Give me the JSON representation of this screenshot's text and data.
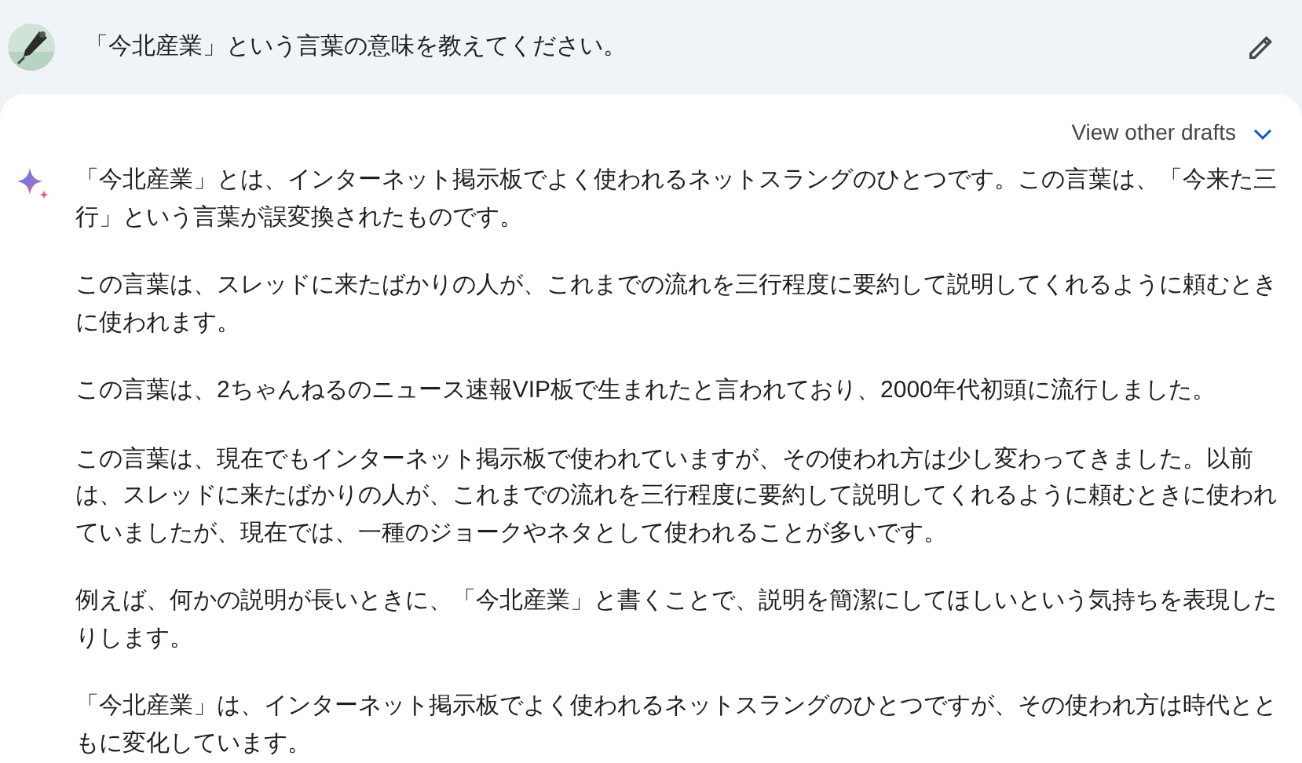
{
  "prompt": {
    "text": "「今北産業」という言葉の意味を教えてください。"
  },
  "response": {
    "drafts_label": "View other drafts",
    "drafts_expanded": false,
    "paragraphs": [
      "「今北産業」とは、インターネット掲示板でよく使われるネットスラングのひとつです。この言葉は、「今来た三行」という言葉が誤変換されたものです。",
      "この言葉は、スレッドに来たばかりの人が、これまでの流れを三行程度に要約して説明してくれるように頼むときに使われます。",
      "この言葉は、2ちゃんねるのニュース速報VIP板で生まれたと言われており、2000年代初頭に流行しました。",
      "この言葉は、現在でもインターネット掲示板で使われていますが、その使われ方は少し変わってきました。以前は、スレッドに来たばかりの人が、これまでの流れを三行程度に要約して説明してくれるように頼むときに使われていましたが、現在では、一種のジョークやネタとして使われることが多いです。",
      "例えば、何かの説明が長いときに、「今北産業」と書くことで、説明を簡潔にしてほしいという気持ちを表現したりします。",
      "「今北産業」は、インターネット掲示板でよく使われるネットスラングのひとつですが、その使われ方は時代とともに変化しています。"
    ]
  }
}
